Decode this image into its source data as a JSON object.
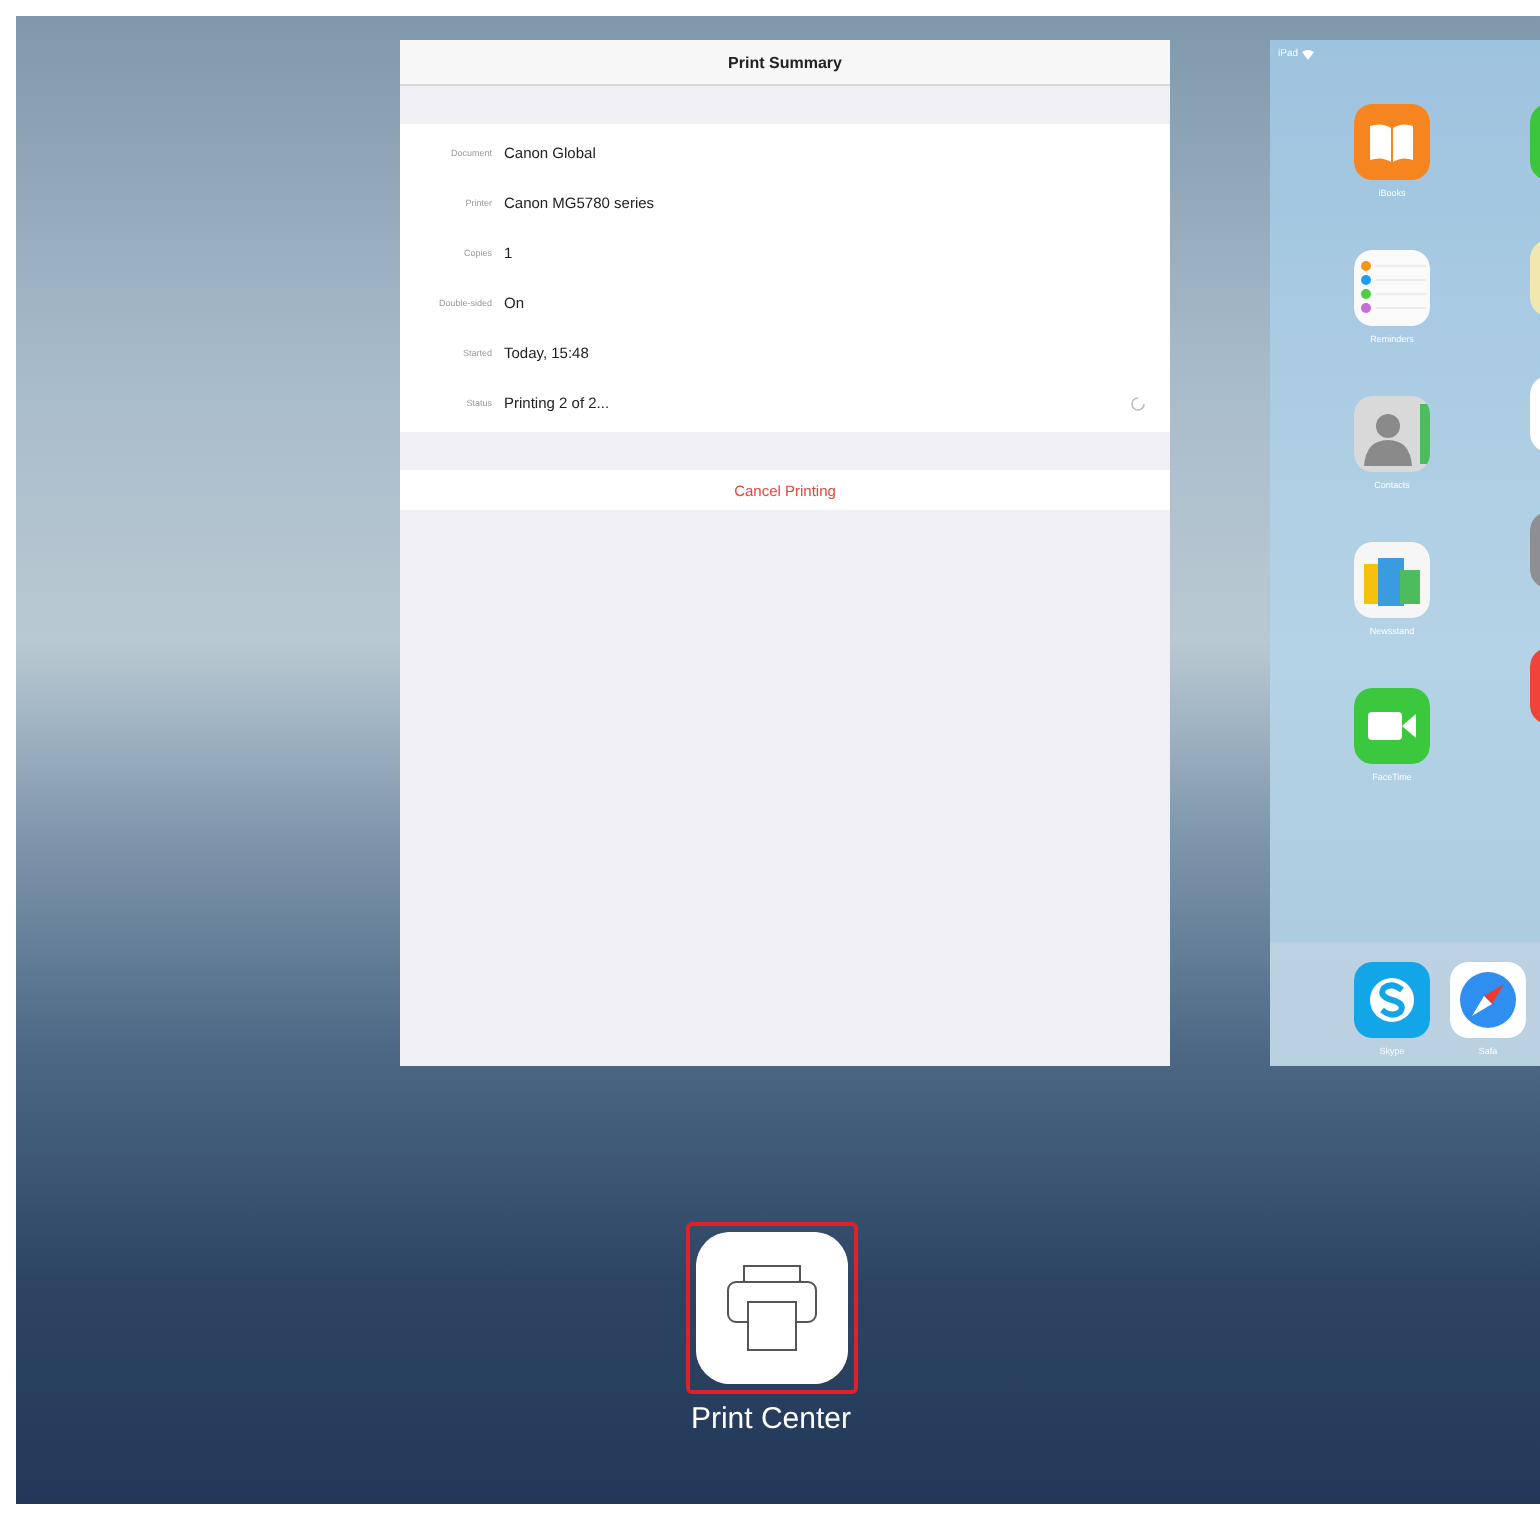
{
  "print_summary": {
    "title": "Print Summary",
    "rows": [
      {
        "label": "Document",
        "value": "Canon Global",
        "busy": false
      },
      {
        "label": "Printer",
        "value": "Canon MG5780 series",
        "busy": false
      },
      {
        "label": "Copies",
        "value": "1",
        "busy": false
      },
      {
        "label": "Double-sided",
        "value": "On",
        "busy": false
      },
      {
        "label": "Started",
        "value": "Today, 15:48",
        "busy": false
      },
      {
        "label": "Status",
        "value": "Printing 2 of 2...",
        "busy": true
      }
    ],
    "action": "Cancel Printing"
  },
  "home_screen": {
    "status_bar": {
      "carrier": "iPad"
    },
    "apps": [
      {
        "label": "iBooks",
        "kind": "ibooks"
      },
      {
        "label": "Reminders",
        "kind": "reminders"
      },
      {
        "label": "Contacts",
        "kind": "contacts"
      },
      {
        "label": "Newsstand",
        "kind": "newsstand"
      },
      {
        "label": "FaceTime",
        "kind": "facetime"
      }
    ],
    "dock": [
      {
        "label": "Skype",
        "kind": "skype"
      },
      {
        "label": "Safa",
        "kind": "safari"
      }
    ]
  },
  "switcher_app": {
    "label": "Print Center",
    "highlighted": true
  }
}
